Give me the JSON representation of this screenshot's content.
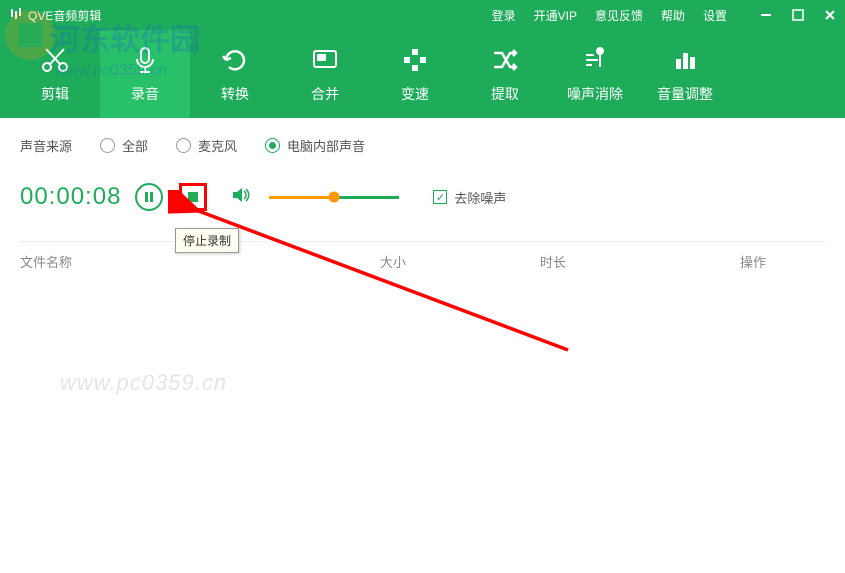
{
  "titlebar": {
    "app_title": "QVE音频剪辑",
    "links": [
      "登录",
      "开通VIP",
      "意见反馈",
      "帮助",
      "设置"
    ]
  },
  "toolbar": {
    "items": [
      {
        "label": "剪辑",
        "icon": "scissors"
      },
      {
        "label": "录音",
        "icon": "mic"
      },
      {
        "label": "转换",
        "icon": "refresh"
      },
      {
        "label": "合并",
        "icon": "merge"
      },
      {
        "label": "变速",
        "icon": "speed"
      },
      {
        "label": "提取",
        "icon": "shuffle"
      },
      {
        "label": "噪声消除",
        "icon": "noise"
      },
      {
        "label": "音量调整",
        "icon": "bars"
      }
    ],
    "active_index": 1
  },
  "source": {
    "label": "声音来源",
    "options": [
      "全部",
      "麦克风",
      "电脑内部声音"
    ],
    "selected_index": 2
  },
  "recording": {
    "timer": "00:00:08",
    "pause_hint": "暂停",
    "stop_hint": "停止录制",
    "denoise_label": "去除噪声",
    "denoise_checked": true,
    "volume_percent": 50
  },
  "table": {
    "headers": {
      "name": "文件名称",
      "size": "大小",
      "duration": "时长",
      "action": "操作"
    }
  },
  "watermark": {
    "text1": "河东软件园",
    "text2": "www.pc0359.cn"
  }
}
